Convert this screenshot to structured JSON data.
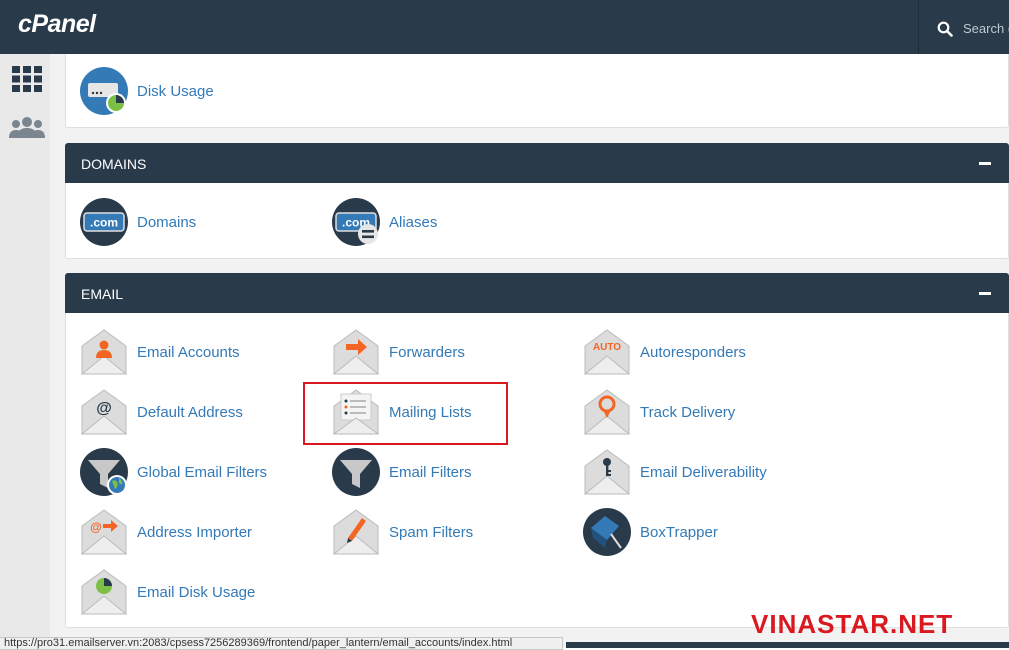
{
  "app": {
    "logo": "cPanel"
  },
  "search": {
    "placeholder": "Search ("
  },
  "sections": {
    "files_partial": {
      "items": [
        {
          "label": "Disk Usage",
          "icon": "disk-usage-icon"
        }
      ]
    },
    "domains": {
      "title": "DOMAINS",
      "items": [
        {
          "label": "Domains",
          "icon": "dotcom-icon"
        },
        {
          "label": "Aliases",
          "icon": "dotcom-alias-icon"
        }
      ]
    },
    "email": {
      "title": "EMAIL",
      "items": [
        {
          "label": "Email Accounts",
          "icon": "email-accounts-icon"
        },
        {
          "label": "Forwarders",
          "icon": "forwarders-icon"
        },
        {
          "label": "Autoresponders",
          "icon": "autoresponders-icon",
          "badge": "AUTO"
        },
        {
          "label": "Default Address",
          "icon": "default-address-icon"
        },
        {
          "label": "Mailing Lists",
          "icon": "mailing-lists-icon"
        },
        {
          "label": "Track Delivery",
          "icon": "track-delivery-icon"
        },
        {
          "label": "Global Email Filters",
          "icon": "global-email-filters-icon"
        },
        {
          "label": "Email Filters",
          "icon": "email-filters-icon"
        },
        {
          "label": "Email Deliverability",
          "icon": "email-deliverability-icon"
        },
        {
          "label": "Address Importer",
          "icon": "address-importer-icon"
        },
        {
          "label": "Spam Filters",
          "icon": "spam-filters-icon"
        },
        {
          "label": "BoxTrapper",
          "icon": "boxtrapper-icon"
        },
        {
          "label": "Email Disk Usage",
          "icon": "email-disk-usage-icon"
        }
      ]
    }
  },
  "statusbar": {
    "url": "https://pro31.emailserver.vn:2083/cpsess7256289369/frontend/paper_lantern/email_accounts/index.html"
  },
  "watermark": "VINASTAR.NET",
  "colors": {
    "header": "#293a4a",
    "link": "#337ab7",
    "highlight": "#d9181f",
    "accent": "#f26522"
  }
}
